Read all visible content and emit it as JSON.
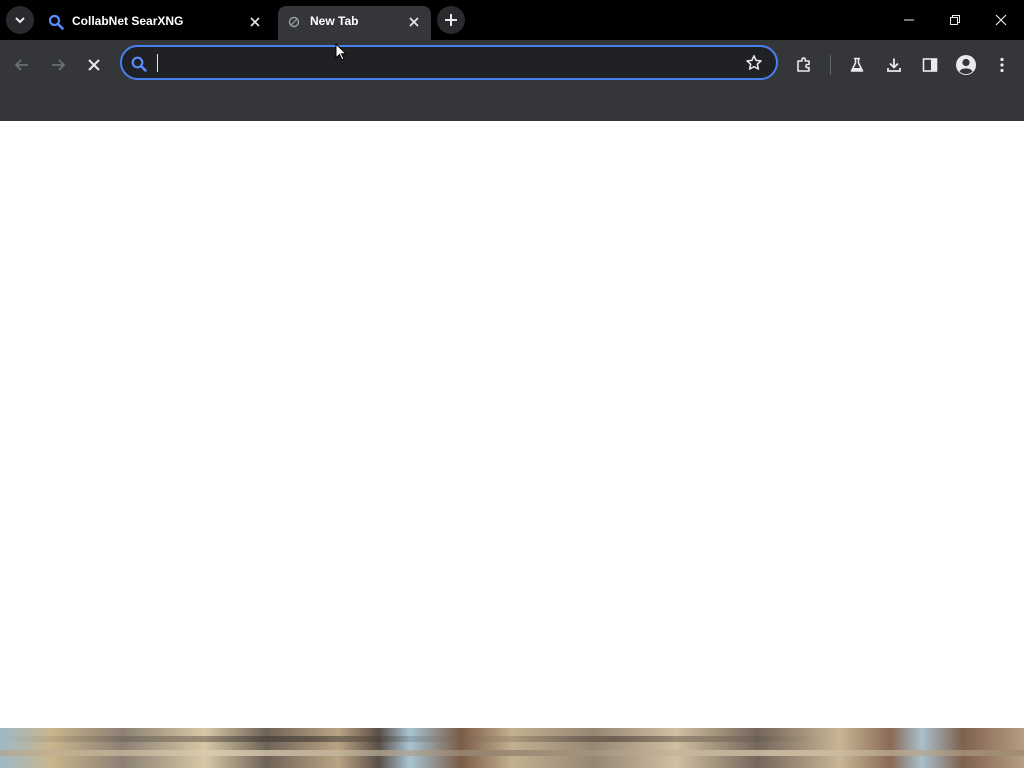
{
  "browser": {
    "tabs": [
      {
        "title": "CollabNet SearXNG",
        "active": false,
        "favicon": "search-icon"
      },
      {
        "title": "New Tab",
        "active": true,
        "favicon": "globe-icon"
      }
    ],
    "window_controls": [
      "minimize-icon",
      "restore-icon",
      "close-icon"
    ],
    "omnibox": {
      "value": "",
      "placeholder": ""
    },
    "toolbar_icons": [
      "back-icon",
      "forward-icon",
      "stop-icon",
      "bookmark-star-icon",
      "extensions-icon",
      "labs-flask-icon",
      "download-icon",
      "side-panel-icon",
      "profile-icon",
      "menu-icon"
    ]
  },
  "colors": {
    "titlebar": "#000000",
    "toolbar": "#35363a",
    "omnibox_border": "#4a7ff0",
    "search_icon": "#5b8cff",
    "content": "#ffffff"
  }
}
